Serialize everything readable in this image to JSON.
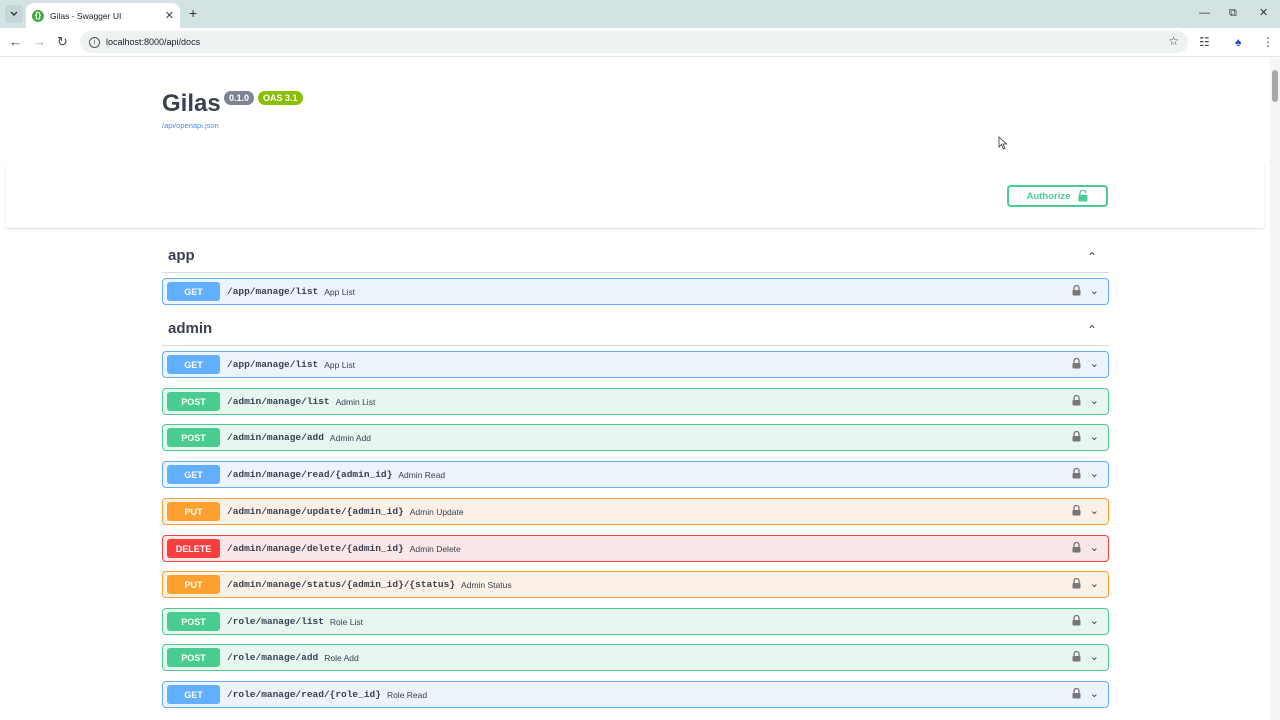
{
  "browser": {
    "tab_title": "Gilas - Swagger UI",
    "url": "localhost:8000/api/docs",
    "new_tab_label": "+",
    "tab_close": "✕"
  },
  "info": {
    "title": "Gilas",
    "version": "0.1.0",
    "oas": "OAS 3.1",
    "spec_url": "/api/openapi.json"
  },
  "authorize": {
    "label": "Authorize"
  },
  "sections": [
    {
      "name": "app"
    },
    {
      "name": "admin"
    }
  ],
  "operations": [
    {
      "method": "GET",
      "path": "/app/manage/list",
      "summary": "App List"
    },
    {
      "method": "GET",
      "path": "/app/manage/list",
      "summary": "App List"
    },
    {
      "method": "POST",
      "path": "/admin/manage/list",
      "summary": "Admin List"
    },
    {
      "method": "POST",
      "path": "/admin/manage/add",
      "summary": "Admin Add"
    },
    {
      "method": "GET",
      "path": "/admin/manage/read/{admin_id}",
      "summary": "Admin Read"
    },
    {
      "method": "PUT",
      "path": "/admin/manage/update/{admin_id}",
      "summary": "Admin Update"
    },
    {
      "method": "DELETE",
      "path": "/admin/manage/delete/{admin_id}",
      "summary": "Admin Delete"
    },
    {
      "method": "PUT",
      "path": "/admin/manage/status/{admin_id}/{status}",
      "summary": "Admin Status"
    },
    {
      "method": "POST",
      "path": "/role/manage/list",
      "summary": "Role List"
    },
    {
      "method": "POST",
      "path": "/role/manage/add",
      "summary": "Role Add"
    },
    {
      "method": "GET",
      "path": "/role/manage/read/{role_id}",
      "summary": "Role Read"
    }
  ],
  "colors": {
    "get": "#61affe",
    "post": "#49cc90",
    "put": "#fca130",
    "delete": "#f93e3e"
  }
}
